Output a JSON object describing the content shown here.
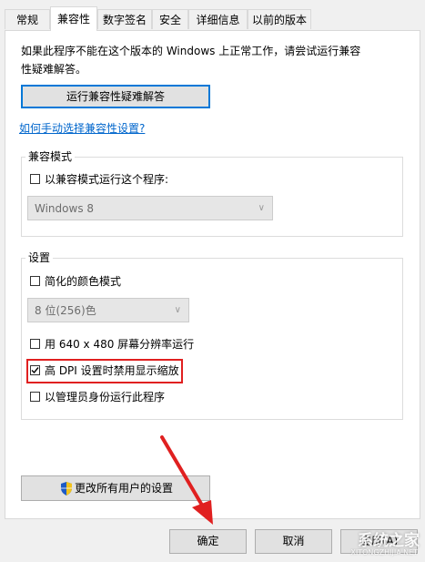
{
  "tabs": [
    {
      "label": "常规",
      "active": false
    },
    {
      "label": "兼容性",
      "active": true
    },
    {
      "label": "数字签名",
      "active": false
    },
    {
      "label": "安全",
      "active": false
    },
    {
      "label": "详细信息",
      "active": false
    },
    {
      "label": "以前的版本",
      "active": false
    }
  ],
  "intro": "如果此程序不能在这个版本的 Windows 上正常工作，请尝试运行兼容性疑难解答。",
  "troubleshoot_button": "运行兼容性疑难解答",
  "manual_link": "如何手动选择兼容性设置?",
  "compat_mode": {
    "title": "兼容模式",
    "checkbox_label": "以兼容模式运行这个程序:",
    "checked": false,
    "select_value": "Windows 8"
  },
  "settings": {
    "title": "设置",
    "reduced_color": {
      "label": "简化的颜色模式",
      "checked": false
    },
    "color_select_value": "8 位(256)色",
    "run_640": {
      "label": "用 640 x 480 屏幕分辨率运行",
      "checked": false
    },
    "high_dpi": {
      "label": "高 DPI 设置时禁用显示缩放",
      "checked": true
    },
    "run_admin": {
      "label": "以管理员身份运行此程序",
      "checked": false
    }
  },
  "change_all_button": "更改所有用户的设置",
  "footer": {
    "ok": "确定",
    "cancel": "取消",
    "apply": "应用(A)"
  },
  "watermark": {
    "text": "系统之家",
    "url": "XITONGZHIJIA.NET"
  },
  "colors": {
    "accent": "#0078d7",
    "highlight": "#e02020",
    "link": "#0066cc"
  }
}
